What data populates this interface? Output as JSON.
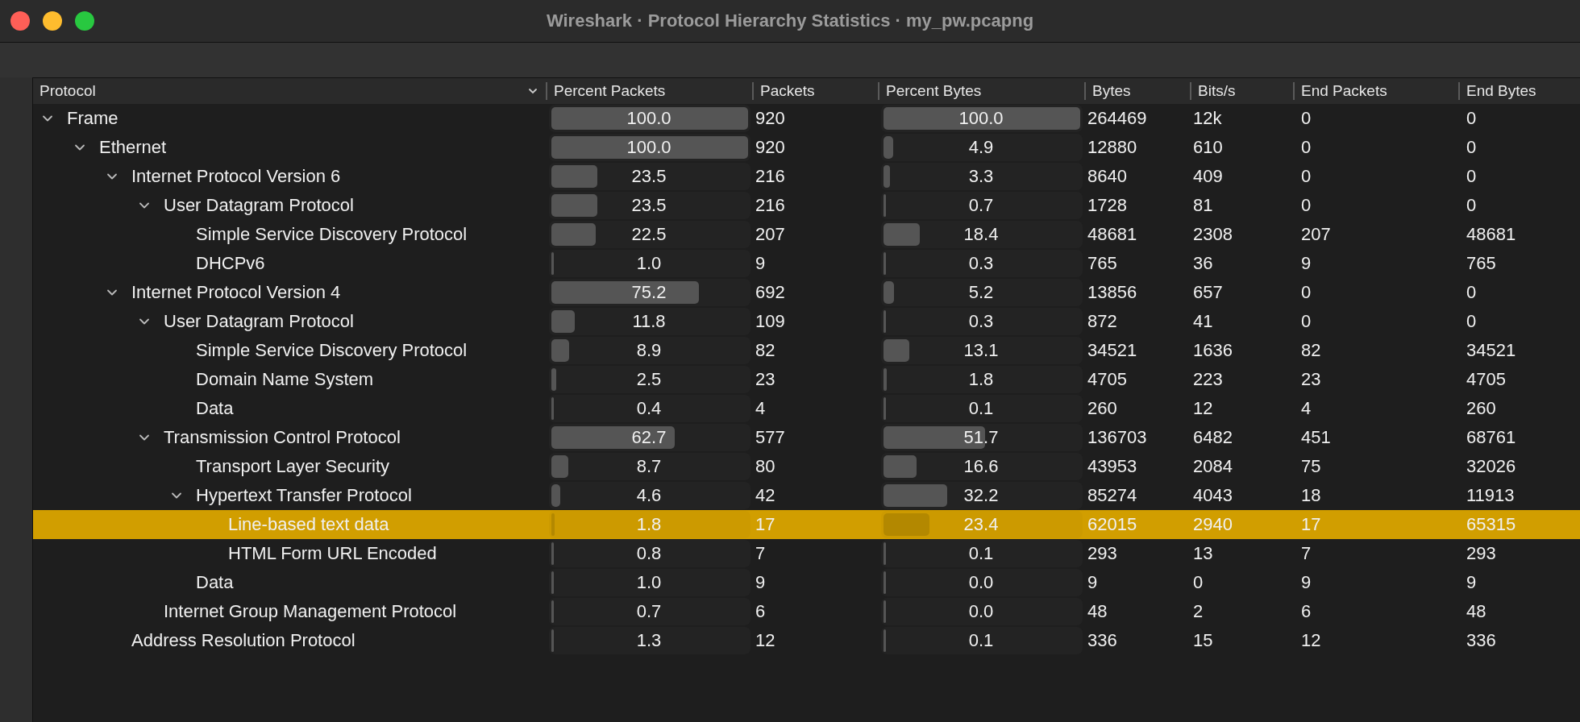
{
  "window": {
    "title": "Wireshark · Protocol Hierarchy Statistics · my_pw.pcapng"
  },
  "columns": [
    "Protocol",
    "Percent Packets",
    "Packets",
    "Percent Bytes",
    "Bytes",
    "Bits/s",
    "End Packets",
    "End Bytes"
  ],
  "rows": [
    {
      "protocol": "Frame",
      "expanded": true,
      "selected": false,
      "percent_packets": {
        "text": "100.0",
        "level": 1.0
      },
      "packets": "920",
      "percent_bytes": {
        "text": "100.0",
        "level": 1.0
      },
      "bytes": "264469",
      "bits_s": "12k",
      "end_packets": "0",
      "end_bytes": "0",
      "children": [
        {
          "protocol": "Ethernet",
          "expanded": true,
          "selected": false,
          "percent_packets": {
            "text": "100.0",
            "level": 1.0
          },
          "packets": "920",
          "percent_bytes": {
            "text": "4.9",
            "level": 0.049
          },
          "bytes": "12880",
          "bits_s": "610",
          "end_packets": "0",
          "end_bytes": "0",
          "children": [
            {
              "protocol": "Internet Protocol Version 6",
              "expanded": true,
              "selected": false,
              "percent_packets": {
                "text": "23.5",
                "level": 0.235
              },
              "packets": "216",
              "percent_bytes": {
                "text": "3.3",
                "level": 0.033
              },
              "bytes": "8640",
              "bits_s": "409",
              "end_packets": "0",
              "end_bytes": "0",
              "children": [
                {
                  "protocol": "User Datagram Protocol",
                  "expanded": true,
                  "selected": false,
                  "percent_packets": {
                    "text": "23.5",
                    "level": 0.235
                  },
                  "packets": "216",
                  "percent_bytes": {
                    "text": "0.7",
                    "level": 0.007
                  },
                  "bytes": "1728",
                  "bits_s": "81",
                  "end_packets": "0",
                  "end_bytes": "0",
                  "children": [
                    {
                      "protocol": "Simple Service Discovery Protocol",
                      "selected": false,
                      "percent_packets": {
                        "text": "22.5",
                        "level": 0.225
                      },
                      "packets": "207",
                      "percent_bytes": {
                        "text": "18.4",
                        "level": 0.184
                      },
                      "bytes": "48681",
                      "bits_s": "2308",
                      "end_packets": "207",
                      "end_bytes": "48681"
                    },
                    {
                      "protocol": "DHCPv6",
                      "selected": false,
                      "percent_packets": {
                        "text": "1.0",
                        "level": 0.01
                      },
                      "packets": "9",
                      "percent_bytes": {
                        "text": "0.3",
                        "level": 0.003
                      },
                      "bytes": "765",
                      "bits_s": "36",
                      "end_packets": "9",
                      "end_bytes": "765"
                    }
                  ]
                }
              ]
            },
            {
              "protocol": "Internet Protocol Version 4",
              "expanded": true,
              "selected": false,
              "percent_packets": {
                "text": "75.2",
                "level": 0.752
              },
              "packets": "692",
              "percent_bytes": {
                "text": "5.2",
                "level": 0.052
              },
              "bytes": "13856",
              "bits_s": "657",
              "end_packets": "0",
              "end_bytes": "0",
              "children": [
                {
                  "protocol": "User Datagram Protocol",
                  "expanded": true,
                  "selected": false,
                  "percent_packets": {
                    "text": "11.8",
                    "level": 0.118
                  },
                  "packets": "109",
                  "percent_bytes": {
                    "text": "0.3",
                    "level": 0.003
                  },
                  "bytes": "872",
                  "bits_s": "41",
                  "end_packets": "0",
                  "end_bytes": "0",
                  "children": [
                    {
                      "protocol": "Simple Service Discovery Protocol",
                      "selected": false,
                      "percent_packets": {
                        "text": "8.9",
                        "level": 0.089
                      },
                      "packets": "82",
                      "percent_bytes": {
                        "text": "13.1",
                        "level": 0.131
                      },
                      "bytes": "34521",
                      "bits_s": "1636",
                      "end_packets": "82",
                      "end_bytes": "34521"
                    },
                    {
                      "protocol": "Domain Name System",
                      "selected": false,
                      "percent_packets": {
                        "text": "2.5",
                        "level": 0.025
                      },
                      "packets": "23",
                      "percent_bytes": {
                        "text": "1.8",
                        "level": 0.018
                      },
                      "bytes": "4705",
                      "bits_s": "223",
                      "end_packets": "23",
                      "end_bytes": "4705"
                    },
                    {
                      "protocol": "Data",
                      "selected": false,
                      "percent_packets": {
                        "text": "0.4",
                        "level": 0.004
                      },
                      "packets": "4",
                      "percent_bytes": {
                        "text": "0.1",
                        "level": 0.001
                      },
                      "bytes": "260",
                      "bits_s": "12",
                      "end_packets": "4",
                      "end_bytes": "260"
                    }
                  ]
                },
                {
                  "protocol": "Transmission Control Protocol",
                  "expanded": true,
                  "selected": false,
                  "percent_packets": {
                    "text": "62.7",
                    "level": 0.627
                  },
                  "packets": "577",
                  "percent_bytes": {
                    "text": "51.7",
                    "level": 0.517
                  },
                  "bytes": "136703",
                  "bits_s": "6482",
                  "end_packets": "451",
                  "end_bytes": "68761",
                  "children": [
                    {
                      "protocol": "Transport Layer Security",
                      "selected": false,
                      "percent_packets": {
                        "text": "8.7",
                        "level": 0.087
                      },
                      "packets": "80",
                      "percent_bytes": {
                        "text": "16.6",
                        "level": 0.166
                      },
                      "bytes": "43953",
                      "bits_s": "2084",
                      "end_packets": "75",
                      "end_bytes": "32026"
                    },
                    {
                      "protocol": "Hypertext Transfer Protocol",
                      "expanded": true,
                      "selected": false,
                      "percent_packets": {
                        "text": "4.6",
                        "level": 0.046
                      },
                      "packets": "42",
                      "percent_bytes": {
                        "text": "32.2",
                        "level": 0.322
                      },
                      "bytes": "85274",
                      "bits_s": "4043",
                      "end_packets": "18",
                      "end_bytes": "11913",
                      "children": [
                        {
                          "protocol": "Line-based text data",
                          "selected": true,
                          "percent_packets": {
                            "text": "1.8",
                            "level": 0.018
                          },
                          "packets": "17",
                          "percent_bytes": {
                            "text": "23.4",
                            "level": 0.234
                          },
                          "bytes": "62015",
                          "bits_s": "2940",
                          "end_packets": "17",
                          "end_bytes": "65315"
                        },
                        {
                          "protocol": "HTML Form URL Encoded",
                          "selected": false,
                          "percent_packets": {
                            "text": "0.8",
                            "level": 0.008
                          },
                          "packets": "7",
                          "percent_bytes": {
                            "text": "0.1",
                            "level": 0.001
                          },
                          "bytes": "293",
                          "bits_s": "13",
                          "end_packets": "7",
                          "end_bytes": "293"
                        }
                      ]
                    },
                    {
                      "protocol": "Data",
                      "selected": false,
                      "percent_packets": {
                        "text": "1.0",
                        "level": 0.01
                      },
                      "packets": "9",
                      "percent_bytes": {
                        "text": "0.0",
                        "level": 0.0
                      },
                      "bytes": "9",
                      "bits_s": "0",
                      "end_packets": "9",
                      "end_bytes": "9"
                    }
                  ]
                },
                {
                  "protocol": "Internet Group Management Protocol",
                  "selected": false,
                  "percent_packets": {
                    "text": "0.7",
                    "level": 0.007
                  },
                  "packets": "6",
                  "percent_bytes": {
                    "text": "0.0",
                    "level": 0.0
                  },
                  "bytes": "48",
                  "bits_s": "2",
                  "end_packets": "6",
                  "end_bytes": "48"
                }
              ]
            },
            {
              "protocol": "Address Resolution Protocol",
              "selected": false,
              "percent_packets": {
                "text": "1.3",
                "level": 0.013
              },
              "packets": "12",
              "percent_bytes": {
                "text": "0.1",
                "level": 0.001
              },
              "bytes": "336",
              "bits_s": "15",
              "end_packets": "12",
              "end_bytes": "336"
            }
          ]
        }
      ]
    }
  ]
}
